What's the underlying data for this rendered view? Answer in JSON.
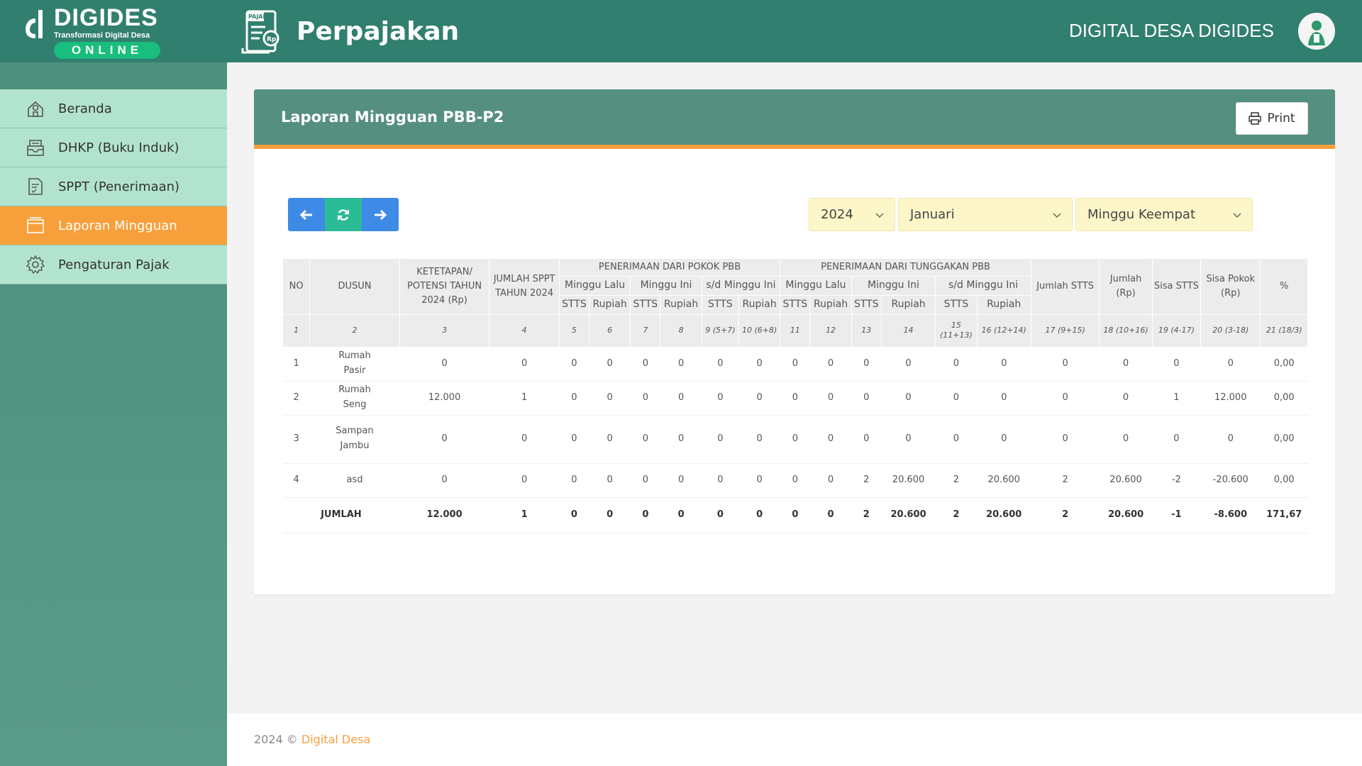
{
  "brand": {
    "name": "DIGIDES",
    "tagline": "Transformasi Digital Desa",
    "badge": "ONLINE",
    "color_header": "#317f6e",
    "color_accent": "#f7a03b",
    "icon": "digides-logo"
  },
  "header": {
    "app_title": "Perpajakan",
    "app_icon": "tax-document-icon",
    "app_icon_label": "PAJAK",
    "app_icon_coin": "Rp",
    "org_name": "DIGITAL DESA DIGIDES",
    "avatar_icon": "user-avatar"
  },
  "sidebar": {
    "items": [
      {
        "label": "Beranda",
        "icon": "home-icon",
        "active": false
      },
      {
        "label": "DHKP (Buku Induk)",
        "icon": "inbox-tray-icon",
        "active": false
      },
      {
        "label": "SPPT (Penerimaan)",
        "icon": "document-check-icon",
        "active": false
      },
      {
        "label": "Laporan Mingguan",
        "icon": "folder-icon",
        "active": true
      },
      {
        "label": "Pengaturan Pajak",
        "icon": "gear-icon",
        "active": false
      }
    ]
  },
  "report": {
    "title": "Laporan Mingguan PBB-P2",
    "print_label": "Print",
    "filters": {
      "year": "2024",
      "month": "Januari",
      "week": "Minggu Keempat"
    },
    "nav_buttons": [
      "arrow-left-icon",
      "refresh-icon",
      "arrow-right-icon"
    ]
  },
  "table": {
    "headers": {
      "no": "NO",
      "dusun": "DUSUN",
      "ketetapan": "KETETAPAN/ POTENSI TAHUN 2024 (Rp)",
      "jumlah_sppt": "JUMLAH SPPT TAHUN 2024",
      "group_pokok": "PENERIMAAN DARI POKOK PBB",
      "group_tunggakan": "PENERIMAAN DARI TUNGGAKAN PBB",
      "minggu_lalu": "Minggu Lalu",
      "minggu_ini": "Minggu Ini",
      "sd_minggu_ini": "s/d Minggu Ini",
      "jumlah_stts": "Jumlah STTS",
      "jumlah_rp": "Jumlah (Rp)",
      "sisa_stts": "Sisa STTS",
      "sisa_pokok": "Sisa Pokok (Rp)",
      "persen": "%",
      "stts": "STTS",
      "rupiah": "Rupiah"
    },
    "col_numbers": [
      "1",
      "2",
      "3",
      "4",
      "5",
      "6",
      "7",
      "8",
      "9 (5+7)",
      "10 (6+8)",
      "11",
      "12",
      "13",
      "14",
      "15 (11+13)",
      "16 (12+14)",
      "17 (9+15)",
      "18 (10+16)",
      "19 (4-17)",
      "20 (3-18)",
      "21 (18/3)"
    ],
    "rows": [
      [
        "1",
        "Rumah Pasir",
        "0",
        "0",
        "0",
        "0",
        "0",
        "0",
        "0",
        "0",
        "0",
        "0",
        "0",
        "0",
        "0",
        "0",
        "0",
        "0",
        "0",
        "0",
        "0,00"
      ],
      [
        "2",
        "Rumah Seng",
        "12.000",
        "1",
        "0",
        "0",
        "0",
        "0",
        "0",
        "0",
        "0",
        "0",
        "0",
        "0",
        "0",
        "0",
        "0",
        "0",
        "1",
        "12.000",
        "0,00"
      ],
      [
        "3",
        "Sampan Jambu",
        "0",
        "0",
        "0",
        "0",
        "0",
        "0",
        "0",
        "0",
        "0",
        "0",
        "0",
        "0",
        "0",
        "0",
        "0",
        "0",
        "0",
        "0",
        "0,00"
      ],
      [
        "4",
        "asd",
        "0",
        "0",
        "0",
        "0",
        "0",
        "0",
        "0",
        "0",
        "0",
        "0",
        "2",
        "20.600",
        "2",
        "20.600",
        "2",
        "20.600",
        "-2",
        "-20.600",
        "0,00"
      ]
    ],
    "total": [
      "JUMLAH",
      "12.000",
      "1",
      "0",
      "0",
      "0",
      "0",
      "0",
      "0",
      "0",
      "0",
      "2",
      "20.600",
      "2",
      "20.600",
      "2",
      "20.600",
      "-1",
      "-8.600",
      "171,67"
    ]
  },
  "footer": {
    "text": "2024 ©",
    "link": "Digital Desa"
  }
}
